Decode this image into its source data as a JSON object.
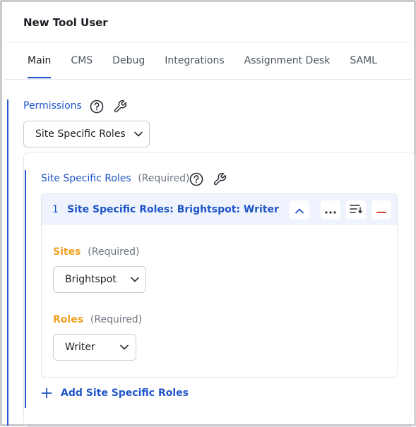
{
  "header": {
    "title": "New Tool User"
  },
  "tabs": [
    {
      "label": "Main",
      "active": true
    },
    {
      "label": "CMS"
    },
    {
      "label": "Debug"
    },
    {
      "label": "Integrations"
    },
    {
      "label": "Assignment Desk"
    },
    {
      "label": "SAML"
    }
  ],
  "permissions": {
    "label": "Permissions",
    "select_value": "Site Specific Roles"
  },
  "site_specific_roles": {
    "label": "Site Specific Roles",
    "required_text": "(Required)",
    "item": {
      "number": "1",
      "title": "Site Specific Roles: Brightspot: Writer",
      "sites": {
        "label": "Sites",
        "required_text": "(Required)",
        "value": "Brightspot"
      },
      "roles": {
        "label": "Roles",
        "required_text": "(Required)",
        "value": "Writer"
      }
    },
    "add_label": "Add Site Specific Roles"
  },
  "colors": {
    "accent": "#1f55c9",
    "field_label": "#f0a020",
    "remove": "#d93a3a"
  }
}
